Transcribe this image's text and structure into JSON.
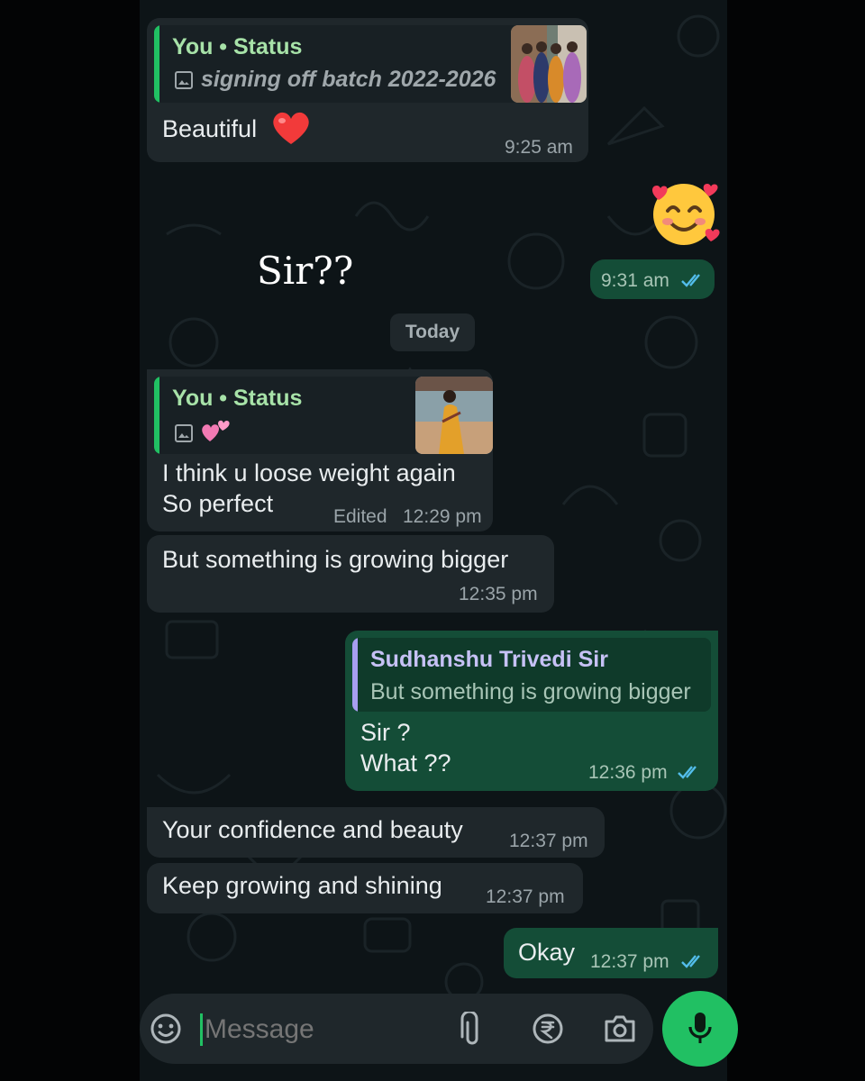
{
  "colors": {
    "accent": "#21c063",
    "quote_name_in": "#a7e2a8",
    "quote_name_out": "#c6c1f5",
    "read_ticks": "#53bdeb"
  },
  "messages": [
    {
      "direction": "in",
      "quote": {
        "name": "You • Status",
        "caption": "signing off batch 2022-2026",
        "icon": "image-icon"
      },
      "text": "Beautiful",
      "emoji": "red-heart-icon",
      "time": "9:25 am"
    },
    {
      "direction": "out",
      "emoji": "smiling-face-with-hearts-icon",
      "time": "9:31 am",
      "status": "read"
    },
    {
      "direction": "in",
      "quote": {
        "name": "You • Status",
        "icon": "image-icon",
        "sticker": "two-hearts-icon"
      },
      "text": "I think u loose weight again\nSo perfect",
      "edited": "Edited",
      "time": "12:29 pm"
    },
    {
      "direction": "in",
      "text": "But something is growing bigger",
      "time": "12:35 pm"
    },
    {
      "direction": "out",
      "quote": {
        "name": "Sudhanshu Trivedi Sir",
        "caption": "But something is growing bigger"
      },
      "text": "Sir ?\nWhat ??",
      "time": "12:36 pm",
      "status": "read"
    },
    {
      "direction": "in",
      "text": "Your confidence and beauty",
      "time": "12:37 pm"
    },
    {
      "direction": "in",
      "text": "Keep growing and shining",
      "time": "12:37 pm"
    },
    {
      "direction": "out",
      "text": "Okay",
      "time": "12:37 pm",
      "status": "read"
    }
  ],
  "overlay_text": "Sir??",
  "date_separator": "Today",
  "composer": {
    "placeholder": "Message",
    "icons": [
      "sticker-icon",
      "attach-icon",
      "rupee-icon",
      "camera-icon",
      "mic-icon"
    ]
  }
}
